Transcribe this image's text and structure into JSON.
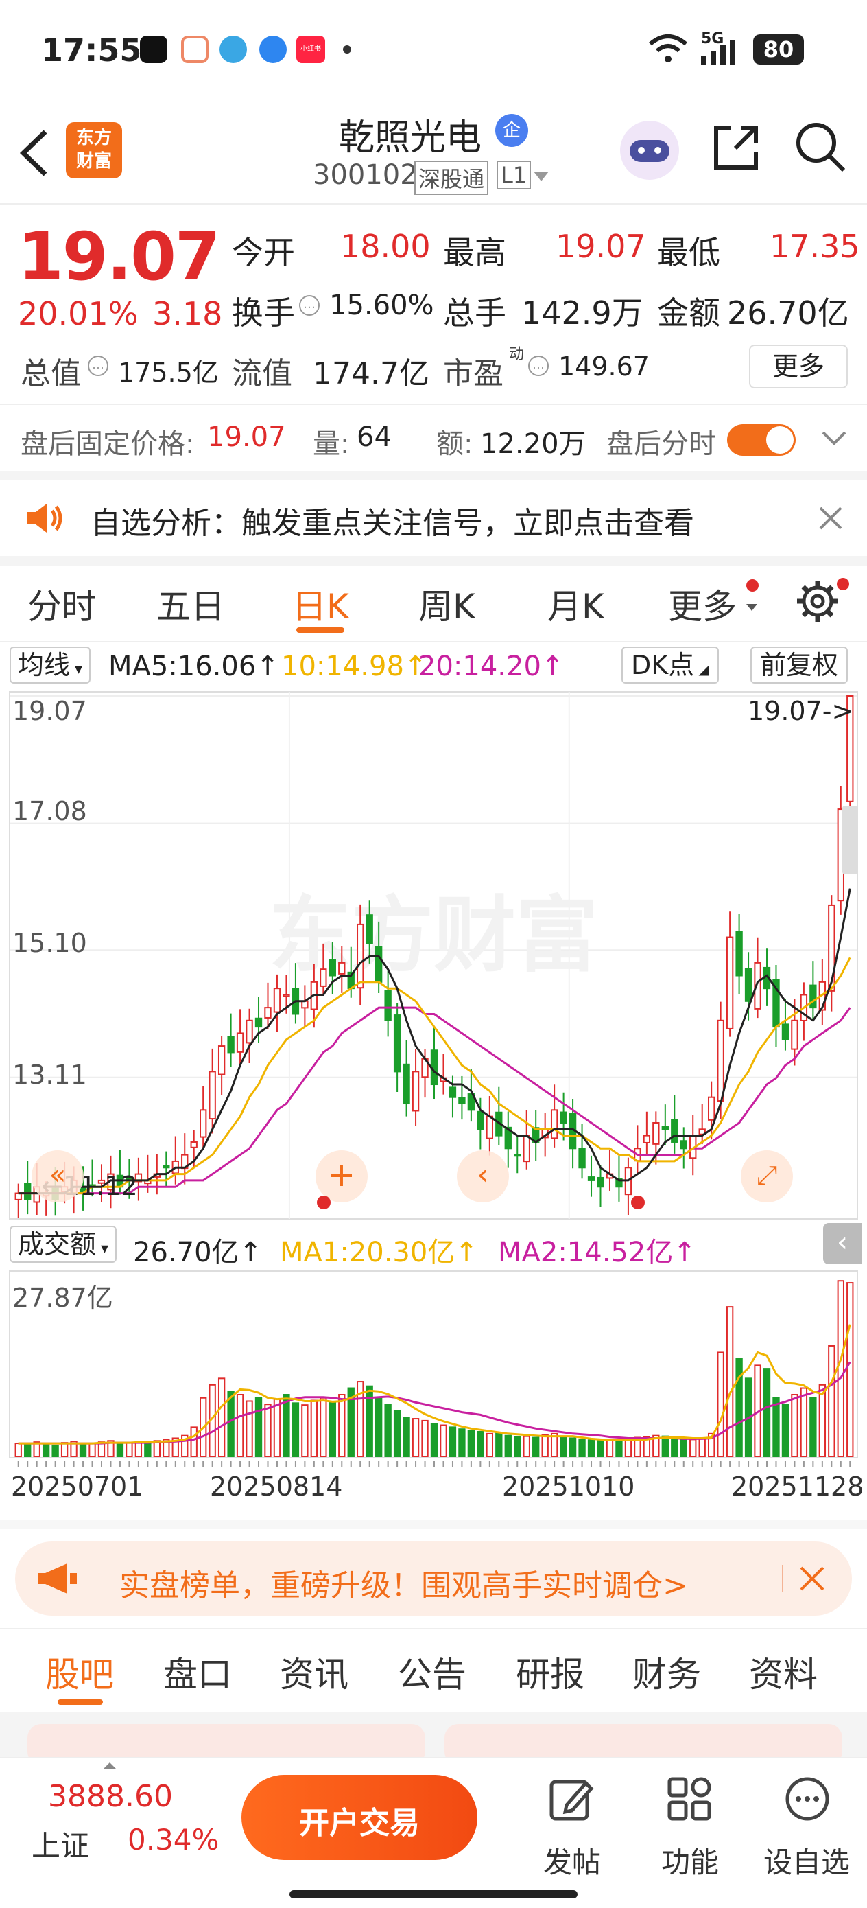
{
  "status_bar": {
    "time": "17:55",
    "network": "5G",
    "battery": "80",
    "app_badge": "小红书"
  },
  "header": {
    "logo_line1": "东方",
    "logo_line2": "财富",
    "stock_name": "乾照光电",
    "badge": "企",
    "stock_code": "300102",
    "market_tag": "深股通",
    "level_tag": "L1"
  },
  "quote": {
    "price": "19.07",
    "change_pct": "20.01%",
    "change_abs": "3.18",
    "open_label": "今开",
    "open": "18.00",
    "high_label": "最高",
    "high": "19.07",
    "low_label": "最低",
    "low": "17.35",
    "turnover_label": "换手",
    "turnover": "15.60%",
    "volume_label": "总手",
    "volume": "142.9万",
    "amount_label": "金额",
    "amount": "26.70亿",
    "mktcap_label": "总值",
    "mktcap": "175.5亿",
    "float_label": "流值",
    "float": "174.7亿",
    "pe_label": "市盈",
    "pe_sup": "动",
    "pe": "149.67",
    "more_button": "更多"
  },
  "after_hours": {
    "price_label": "盘后固定价格:",
    "price": "19.07",
    "vol_label": "量:",
    "vol": "64",
    "amt_label": "额:",
    "amt": "12.20万",
    "toggle_label": "盘后分时"
  },
  "notice": {
    "text": "自选分析：触发重点关注信号，立即点击查看"
  },
  "period_tabs": [
    "分时",
    "五日",
    "日K",
    "周K",
    "月K",
    "更多"
  ],
  "active_tab": "日K",
  "chart_header": {
    "ma_select": "均线",
    "ma5": "MA5:16.06↑",
    "ma10": "10:14.98↑",
    "ma20": "20:14.20↑",
    "dk_button": "DK点",
    "adjust_button": "前复权"
  },
  "kline_axis": [
    "19.07",
    "17.08",
    "15.10",
    "13.11"
  ],
  "kline_last_label": "19.07->",
  "kline_low_label": "11.12",
  "watermark": "东方财富",
  "volume_header": {
    "select": "成交额",
    "value": "26.70亿↑",
    "ma1": "MA1:20.30亿↑",
    "ma2": "MA2:14.52亿↑",
    "max_label": "27.87亿"
  },
  "date_axis": [
    "20250701",
    "20250814",
    "20251010",
    "20251128"
  ],
  "promo": {
    "text": "实盘榜单，重磅升级！围观高手实时调仓>"
  },
  "content_tabs": [
    "股吧",
    "盘口",
    "资讯",
    "公告",
    "研报",
    "财务",
    "资料"
  ],
  "bottom_bar": {
    "index_value": "3888.60",
    "index_name": "上证",
    "index_change": "0.34%",
    "trade_button": "开户交易",
    "post_label": "发帖",
    "func_label": "功能",
    "watch_label": "设自选"
  },
  "chart_data": {
    "type": "candlestick",
    "ylim": [
      11.12,
      19.07
    ],
    "close": [
      11.3,
      11.2,
      11.4,
      11.3,
      11.2,
      11.4,
      11.5,
      11.3,
      11.4,
      11.5,
      11.6,
      11.4,
      11.5,
      11.6,
      11.5,
      11.6,
      11.7,
      11.8,
      11.9,
      12.1,
      12.6,
      13.2,
      13.6,
      13.5,
      13.8,
      14.0,
      13.9,
      14.2,
      14.5,
      14.4,
      14.1,
      14.3,
      14.6,
      14.8,
      14.7,
      14.9,
      14.5,
      15.5,
      15.2,
      14.6,
      14.0,
      13.2,
      12.7,
      13.2,
      13.4,
      13.0,
      13.1,
      12.8,
      12.7,
      12.6,
      12.3,
      12.5,
      12.2,
      12.0,
      11.9,
      12.2,
      12.1,
      12.3,
      12.6,
      12.4,
      12.0,
      11.7,
      11.5,
      11.4,
      11.6,
      11.4,
      11.7,
      12.0,
      12.2,
      12.4,
      12.3,
      12.1,
      12.0,
      12.2,
      12.3,
      12.8,
      14.0,
      15.3,
      14.7,
      14.3,
      14.9,
      14.5,
      13.9,
      13.7,
      14.0,
      14.4,
      14.2,
      14.6,
      15.8,
      17.3,
      19.07
    ],
    "ma5": [
      11.3,
      11.3,
      11.3,
      11.3,
      11.3,
      11.3,
      11.4,
      11.4,
      11.4,
      11.4,
      11.5,
      11.5,
      11.5,
      11.5,
      11.5,
      11.6,
      11.6,
      11.7,
      11.7,
      11.8,
      12.0,
      12.3,
      12.6,
      12.9,
      13.3,
      13.6,
      13.8,
      13.9,
      14.1,
      14.2,
      14.3,
      14.3,
      14.4,
      14.4,
      14.6,
      14.7,
      14.7,
      14.9,
      15.0,
      15.0,
      14.8,
      14.5,
      14.0,
      13.6,
      13.4,
      13.2,
      13.1,
      13.0,
      13.0,
      12.9,
      12.6,
      12.5,
      12.4,
      12.3,
      12.2,
      12.2,
      12.1,
      12.2,
      12.3,
      12.3,
      12.3,
      12.2,
      12.0,
      11.7,
      11.6,
      11.5,
      11.5,
      11.6,
      11.7,
      11.9,
      12.1,
      12.2,
      12.2,
      12.2,
      12.2,
      12.3,
      12.7,
      13.3,
      13.8,
      14.2,
      14.6,
      14.7,
      14.5,
      14.3,
      14.2,
      14.1,
      14.0,
      14.2,
      14.6,
      15.3,
      16.06
    ],
    "ma10": [
      11.3,
      11.3,
      11.3,
      11.3,
      11.3,
      11.3,
      11.3,
      11.3,
      11.4,
      11.4,
      11.4,
      11.4,
      11.5,
      11.5,
      11.5,
      11.5,
      11.5,
      11.6,
      11.6,
      11.7,
      11.8,
      11.9,
      12.1,
      12.3,
      12.5,
      12.8,
      13.0,
      13.3,
      13.5,
      13.7,
      13.8,
      13.9,
      14.0,
      14.2,
      14.3,
      14.4,
      14.5,
      14.6,
      14.6,
      14.6,
      14.5,
      14.5,
      14.4,
      14.3,
      14.1,
      13.9,
      13.7,
      13.5,
      13.3,
      13.2,
      13.0,
      12.9,
      12.7,
      12.6,
      12.5,
      12.4,
      12.3,
      12.3,
      12.3,
      12.2,
      12.2,
      12.2,
      12.1,
      12.0,
      12.0,
      11.9,
      11.9,
      11.8,
      11.8,
      11.8,
      11.8,
      11.8,
      11.9,
      12.0,
      12.1,
      12.2,
      12.4,
      12.7,
      13.0,
      13.2,
      13.5,
      13.7,
      13.9,
      14.0,
      14.1,
      14.2,
      14.3,
      14.4,
      14.5,
      14.7,
      14.98
    ],
    "ma20": [
      11.3,
      11.3,
      11.3,
      11.3,
      11.3,
      11.3,
      11.3,
      11.3,
      11.3,
      11.3,
      11.3,
      11.3,
      11.3,
      11.4,
      11.4,
      11.4,
      11.4,
      11.4,
      11.5,
      11.5,
      11.5,
      11.6,
      11.7,
      11.8,
      11.9,
      12.0,
      12.2,
      12.4,
      12.6,
      12.7,
      12.9,
      13.1,
      13.3,
      13.5,
      13.6,
      13.8,
      13.9,
      14.0,
      14.1,
      14.2,
      14.2,
      14.2,
      14.2,
      14.2,
      14.1,
      14.1,
      14.0,
      13.9,
      13.8,
      13.7,
      13.6,
      13.5,
      13.4,
      13.3,
      13.2,
      13.1,
      13.0,
      12.9,
      12.8,
      12.7,
      12.6,
      12.5,
      12.4,
      12.3,
      12.2,
      12.1,
      12.0,
      11.9,
      11.9,
      11.9,
      11.9,
      11.9,
      11.9,
      12.0,
      12.0,
      12.1,
      12.2,
      12.3,
      12.4,
      12.6,
      12.8,
      13.0,
      13.1,
      13.3,
      13.4,
      13.6,
      13.7,
      13.8,
      13.9,
      14.0,
      14.2
    ],
    "volume_yi": [
      2.0,
      1.8,
      2.2,
      1.9,
      1.7,
      2.1,
      2.3,
      1.9,
      2.0,
      2.2,
      2.4,
      2.0,
      2.1,
      2.3,
      2.2,
      2.4,
      2.6,
      2.8,
      3.2,
      4.5,
      9.0,
      11.0,
      12.0,
      10.0,
      9.5,
      8.5,
      9.0,
      8.0,
      8.8,
      9.5,
      8.2,
      7.9,
      8.6,
      9.0,
      8.3,
      9.5,
      10.5,
      11.5,
      10.8,
      9.0,
      8.0,
      7.0,
      6.0,
      5.8,
      5.5,
      5.0,
      4.8,
      4.5,
      4.2,
      4.0,
      3.8,
      3.5,
      3.6,
      3.2,
      3.0,
      3.1,
      2.9,
      3.3,
      3.5,
      3.1,
      2.8,
      2.6,
      2.5,
      2.4,
      2.6,
      2.3,
      2.5,
      2.9,
      3.0,
      3.2,
      3.1,
      2.8,
      2.7,
      2.6,
      2.8,
      3.5,
      16.0,
      23.0,
      15.0,
      12.0,
      14.0,
      13.5,
      9.0,
      8.0,
      9.5,
      10.5,
      9.0,
      11.0,
      17.0,
      27.0,
      26.7
    ],
    "vol_ma1": [
      2.0,
      2.0,
      2.0,
      2.0,
      2.0,
      2.0,
      2.0,
      2.0,
      2.0,
      2.1,
      2.1,
      2.1,
      2.1,
      2.2,
      2.2,
      2.3,
      2.3,
      2.4,
      2.6,
      3.1,
      4.4,
      5.9,
      7.7,
      9.1,
      10.3,
      10.2,
      9.8,
      9.0,
      8.8,
      8.9,
      8.8,
      8.5,
      8.5,
      8.6,
      8.4,
      8.5,
      9.0,
      9.7,
      10.1,
      10.0,
      9.6,
      8.9,
      8.2,
      7.3,
      6.5,
      5.9,
      5.4,
      5.0,
      4.6,
      4.3,
      4.1,
      3.9,
      3.7,
      3.5,
      3.4,
      3.3,
      3.2,
      3.1,
      3.1,
      3.1,
      3.1,
      2.9,
      2.7,
      2.6,
      2.5,
      2.5,
      2.5,
      2.5,
      2.6,
      2.8,
      2.9,
      2.9,
      2.9,
      2.8,
      2.8,
      2.9,
      5.5,
      9.7,
      12.2,
      13.6,
      16.0,
      15.5,
      12.7,
      11.3,
      11.2,
      10.9,
      10.0,
      9.6,
      11.4,
      14.9,
      20.3
    ],
    "vol_ma2": [
      2.0,
      2.0,
      2.0,
      2.0,
      2.0,
      2.0,
      2.0,
      2.0,
      2.0,
      2.0,
      2.1,
      2.1,
      2.1,
      2.1,
      2.1,
      2.2,
      2.2,
      2.3,
      2.4,
      2.6,
      3.1,
      3.8,
      4.7,
      5.5,
      6.2,
      6.6,
      7.0,
      7.4,
      7.9,
      8.4,
      8.9,
      9.1,
      9.1,
      9.1,
      9.0,
      8.8,
      8.8,
      8.9,
      9.0,
      9.1,
      9.2,
      9.0,
      8.7,
      8.3,
      8.0,
      7.7,
      7.4,
      7.1,
      6.8,
      6.6,
      6.4,
      6.0,
      5.6,
      5.2,
      4.9,
      4.6,
      4.3,
      4.1,
      3.9,
      3.7,
      3.5,
      3.4,
      3.3,
      3.2,
      3.0,
      2.9,
      2.8,
      2.8,
      2.8,
      2.8,
      2.8,
      2.8,
      2.7,
      2.7,
      2.7,
      2.8,
      3.5,
      4.5,
      5.2,
      5.9,
      6.8,
      7.6,
      8.0,
      8.4,
      8.9,
      9.4,
      9.8,
      10.2,
      11.0,
      12.1,
      14.52
    ]
  }
}
